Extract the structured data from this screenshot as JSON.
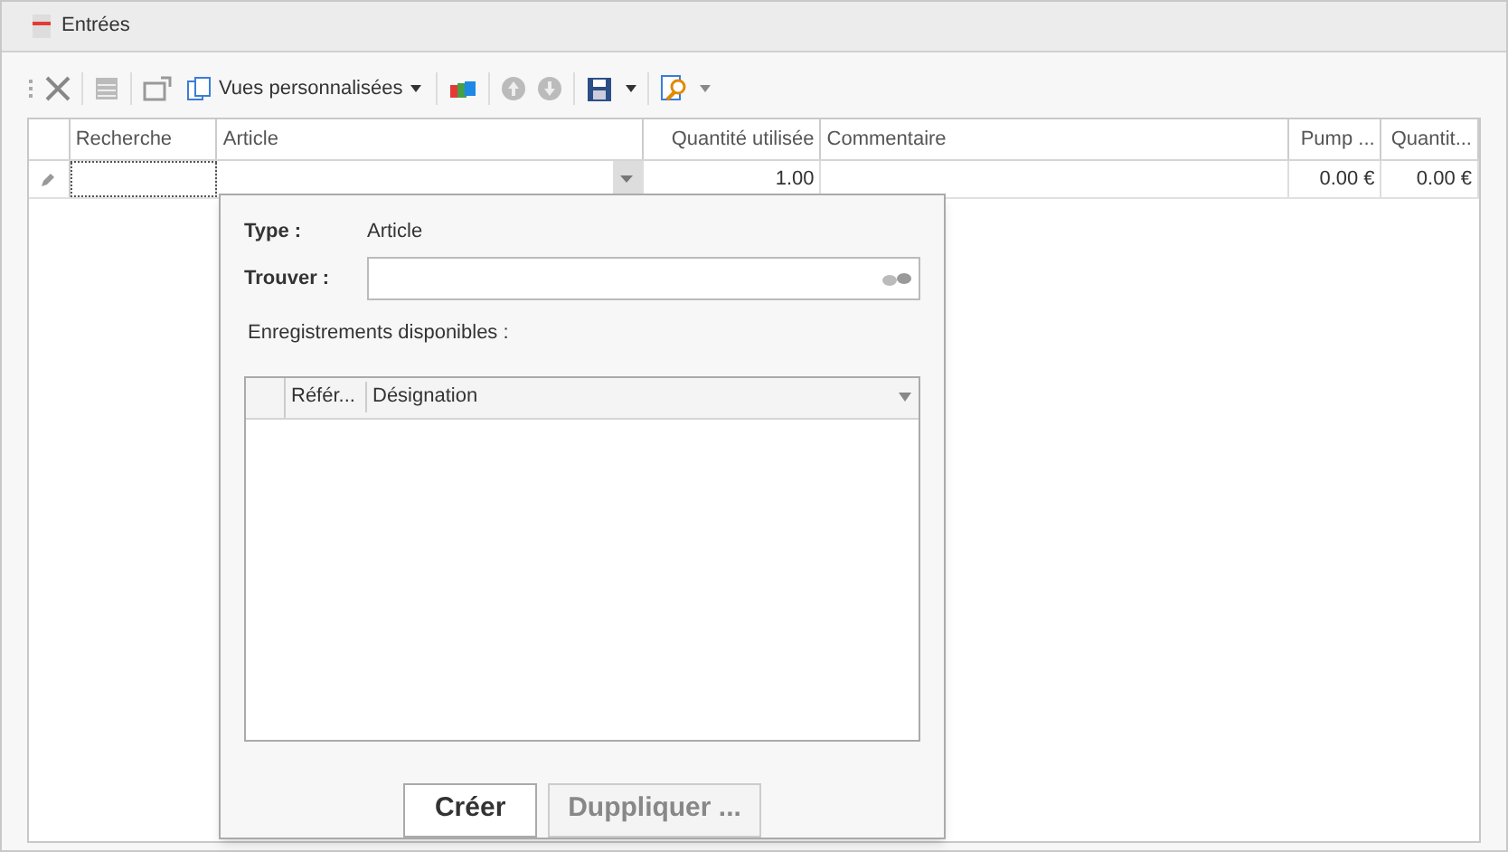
{
  "tab": {
    "title": "Entrées"
  },
  "toolbar": {
    "views_label": "Vues personnalisées"
  },
  "grid": {
    "columns": [
      "Recherche",
      "Article",
      "Quantité utilisée",
      "Commentaire",
      "Pump ...",
      "Quantit..."
    ],
    "rows": [
      {
        "editing": true,
        "cells": [
          "",
          "",
          "1.00",
          "",
          "0.00 €",
          "0.00 €"
        ]
      }
    ]
  },
  "popup": {
    "type_label": "Type :",
    "type_value": "Article",
    "find_label": "Trouver :",
    "records_label": "Enregistrements disponibles :",
    "columns": [
      "Référ...",
      "Désignation"
    ],
    "buttons": [
      {
        "label": "Créer",
        "disabled": false
      },
      {
        "label": "Duppliquer ...",
        "disabled": true
      }
    ]
  }
}
